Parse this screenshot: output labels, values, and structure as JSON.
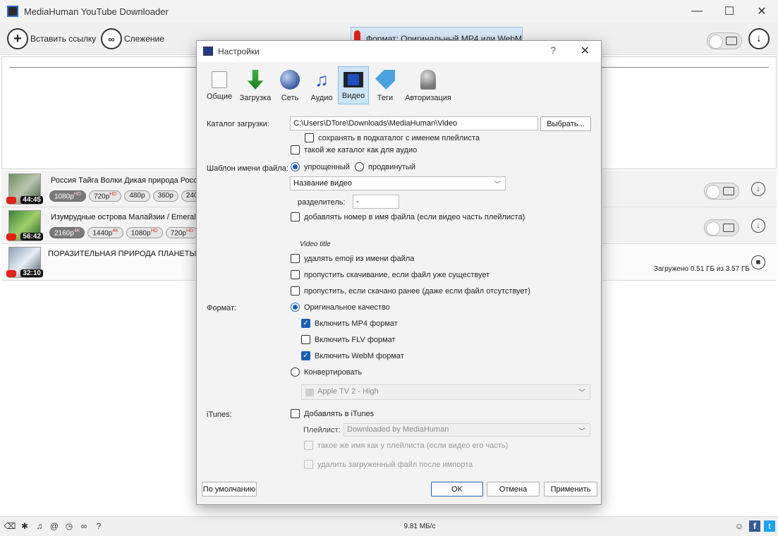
{
  "window": {
    "title": "MediaHuman YouTube Downloader"
  },
  "toolbar": {
    "paste_label": "Вставить ссылку",
    "tracking_label": "Слежение",
    "format_label": "Формат: Оригинальный MP4 или WebM"
  },
  "downloads": [
    {
      "title": "Россия Тайга Волки Дикая природа России",
      "duration": "44:45",
      "chips": [
        {
          "label": "1080p",
          "sup": "HD",
          "selected": true
        },
        {
          "label": "720p",
          "sup": "HD",
          "selected": false
        },
        {
          "label": "480p",
          "sup": "",
          "selected": false
        },
        {
          "label": "360p",
          "sup": "",
          "selected": false
        },
        {
          "label": "240p",
          "sup": "",
          "selected": false
        }
      ]
    },
    {
      "title": "Изумрудные острова Малайзии / Emerald",
      "duration": "56:42",
      "chips": [
        {
          "label": "2160p",
          "sup": "4K",
          "selected": true
        },
        {
          "label": "1440p",
          "sup": "4K",
          "selected": false
        },
        {
          "label": "1080p",
          "sup": "HD",
          "selected": false
        },
        {
          "label": "720p",
          "sup": "HD",
          "selected": false
        }
      ]
    },
    {
      "title": "ПОРАЗИТЕЛЬНАЯ ПРИРОДА ПЛАНЕТЫ ЗЕМЛЯ",
      "duration": "32:10",
      "status": "Загружено 0.51 ГБ из 3.57 ГБ"
    }
  ],
  "statusbar": {
    "speed": "9.81 МБ/с"
  },
  "dialog": {
    "title": "Настройки",
    "tabs": [
      "Общие",
      "Загрузка",
      "Сеть",
      "Аудио",
      "Видео",
      "Теги",
      "Авторизация"
    ],
    "active_tab": "Видео",
    "download_dir_label": "Каталог загрузки:",
    "download_dir_value": "C:\\Users\\DTore\\Downloads\\MediaHuman\\Video",
    "browse_label": "Выбрать...",
    "save_subdir_label": "сохранять в подкаталог с именем плейлиста",
    "same_dir_label": "такой же каталог как для аудио",
    "template_label": "Шаблон имени файла:",
    "simple_label": "упрощенный",
    "advanced_label": "продвинутый",
    "template_value": "Название видео",
    "separator_label": "разделитель:",
    "separator_value": "-",
    "add_number_label": "добавлять номер в имя файла (если видео часть плейлиста)",
    "preview": "Video title",
    "remove_emoji_label": "удалять emoji из имени файла",
    "skip_exists_label": "пропустить скачивание, если файл уже существует",
    "skip_downloaded_label": "пропустить, если скачано ранее (даже если файл отсутствует)",
    "format_label": "Формат:",
    "original_label": "Оригинальное качество",
    "mp4_label": "Включить MP4 формат",
    "flv_label": "Включить FLV формат",
    "webm_label": "Включить WebM формат",
    "convert_label": "Конвертировать",
    "convert_preset": "Apple TV 2 - High",
    "itunes_label": "iTunes:",
    "add_itunes_label": "Добавлять в iTunes",
    "playlist_label": "Плейлист:",
    "playlist_value": "Downloaded by MediaHuman",
    "same_name_label": "такое же имя как у плейлиста (если видео его часть)",
    "delete_after_label": "удалить загруженный файл после импорта",
    "default_button": "По умолчанию",
    "ok_button": "OK",
    "cancel_button": "Отмена",
    "apply_button": "Применить"
  }
}
